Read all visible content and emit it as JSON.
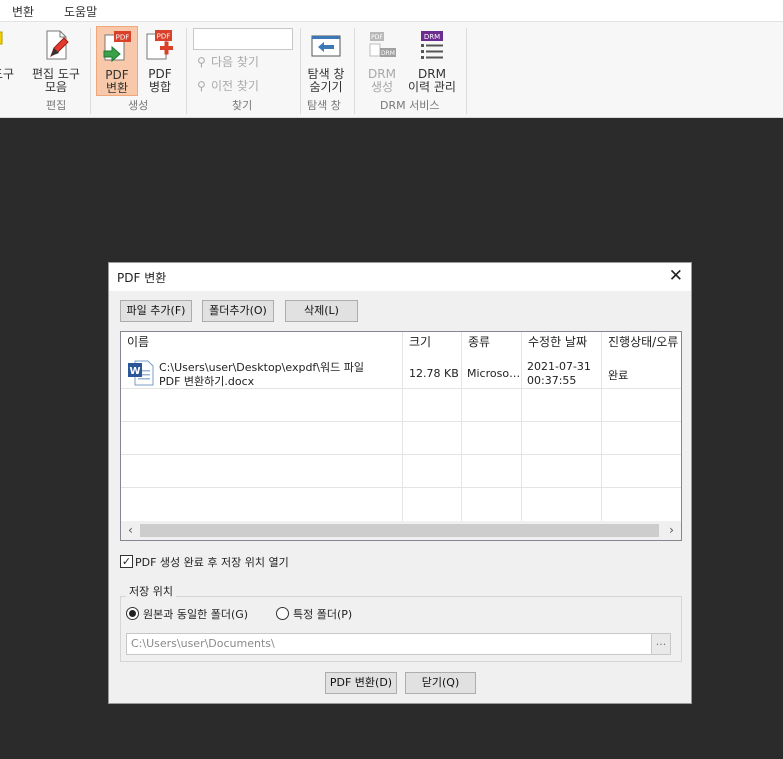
{
  "menubar": {
    "items": [
      "변환",
      "도움말"
    ]
  },
  "ribbon": {
    "edit_toolbar_label": "편집 도구\n모음",
    "edit_group": "편집",
    "pdf_convert_label": "PDF\n변환",
    "pdf_merge_label": "PDF\n병합",
    "create_group": "생성",
    "find_next": "다음 찾기",
    "find_prev": "이전 찾기",
    "find_group": "찾기",
    "hide_nav_label": "탐색 창\n숨기기",
    "nav_group": "탐색 창",
    "drm_create_label": "DRM\n생성",
    "drm_history_label": "DRM\n이력 관리",
    "drm_group": "DRM 서비스",
    "partial_left_label": "도구"
  },
  "dialog": {
    "title": "PDF 변환",
    "close_glyph": "✕",
    "buttons": {
      "add_file": "파일 추가(F)",
      "add_folder": "폴더추가(O)",
      "delete": "삭제(L)"
    },
    "columns": [
      "이름",
      "크기",
      "종류",
      "수정한 날짜",
      "진행상태/오류"
    ],
    "rows": [
      {
        "name_line1": "C:\\Users\\user\\Desktop\\expdf\\워드 파일",
        "name_line2": "PDF 변환하기.docx",
        "size": "12.78 KB",
        "type": "Microso…",
        "date_line1": "2021-07-31",
        "date_line2": "00:37:55",
        "status": "완료"
      }
    ],
    "open_after_label": "PDF 생성 완료 후 저장 위치 열기",
    "open_after_checked": true,
    "save_location_title": "저장 위치",
    "radio_same": "원본과 동일한 폴더(G)",
    "radio_specific": "특정 폴더(P)",
    "path_value": "C:\\Users\\user\\Documents\\",
    "browse_label": "...",
    "convert_button": "PDF 변환(D)",
    "close_button": "닫기(Q)"
  },
  "colors": {
    "background": "#2b2b2b",
    "ribbon_active": "#f7c8a9",
    "word_blue": "#2b579a",
    "pdf_red": "#d9412b",
    "drm_purple": "#6b2d8f",
    "nav_blue": "#3c78b5"
  },
  "icons": [
    "edit-toolbar-icon",
    "pdf-convert-icon",
    "pdf-merge-icon",
    "search-icon",
    "hide-nav-icon",
    "drm-create-icon",
    "drm-history-icon",
    "word-doc-icon",
    "checkbox-check-icon",
    "close-icon"
  ]
}
